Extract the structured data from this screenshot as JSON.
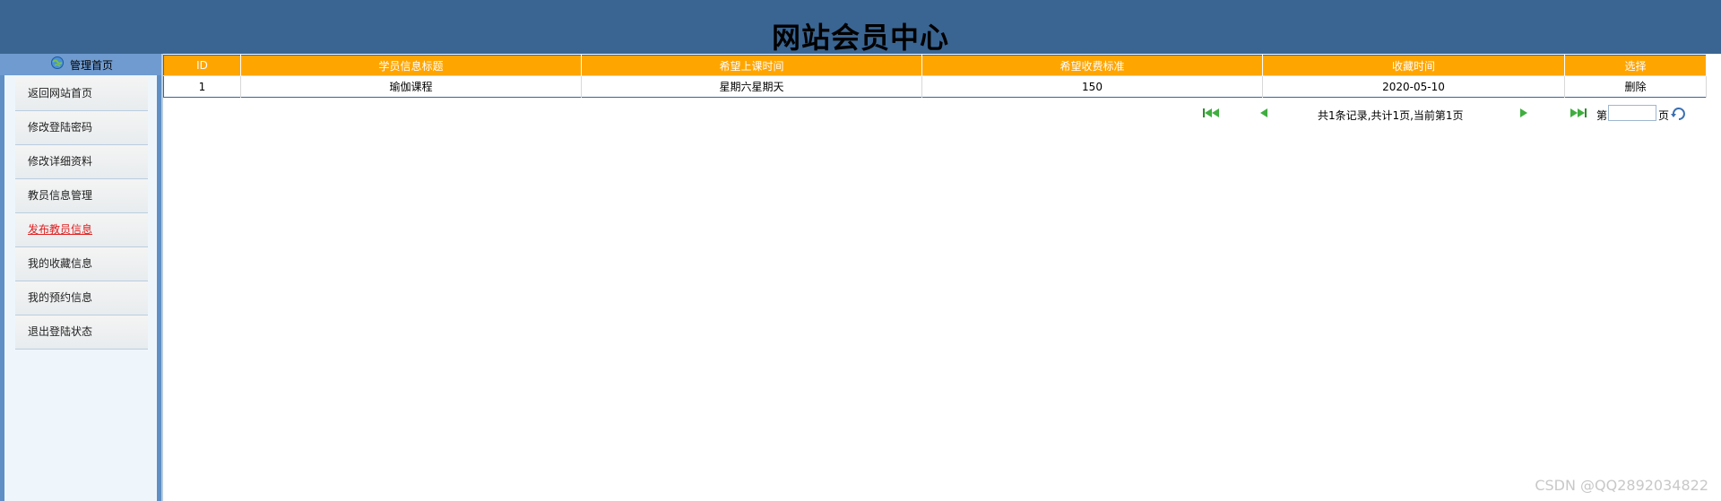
{
  "header": {
    "title": "网站会员中心"
  },
  "sidebar": {
    "head_label": "管理首页",
    "items": [
      {
        "label": "返回网站首页",
        "active": false
      },
      {
        "label": "修改登陆密码",
        "active": false
      },
      {
        "label": "修改详细资料",
        "active": false
      },
      {
        "label": "教员信息管理",
        "active": false
      },
      {
        "label": "发布教员信息",
        "active": true
      },
      {
        "label": "我的收藏信息",
        "active": false
      },
      {
        "label": "我的预约信息",
        "active": false
      },
      {
        "label": "退出登陆状态",
        "active": false
      }
    ]
  },
  "table": {
    "columns": [
      "ID",
      "学员信息标题",
      "希望上课时间",
      "希望收费标准",
      "收藏时间",
      "选择"
    ],
    "rows": [
      [
        "1",
        "瑜伽课程",
        "星期六星期天",
        "150",
        "2020-05-10",
        "删除"
      ]
    ]
  },
  "pager": {
    "info": "共1条记录,共计1页,当前第1页",
    "page_prefix": "第",
    "page_suffix": "页",
    "page_input_value": ""
  },
  "watermark": "CSDN @QQ2892034822",
  "colors": {
    "header_bg": "#3a6592",
    "table_header_bg": "#ffa500",
    "active_menu": "#e02020"
  }
}
